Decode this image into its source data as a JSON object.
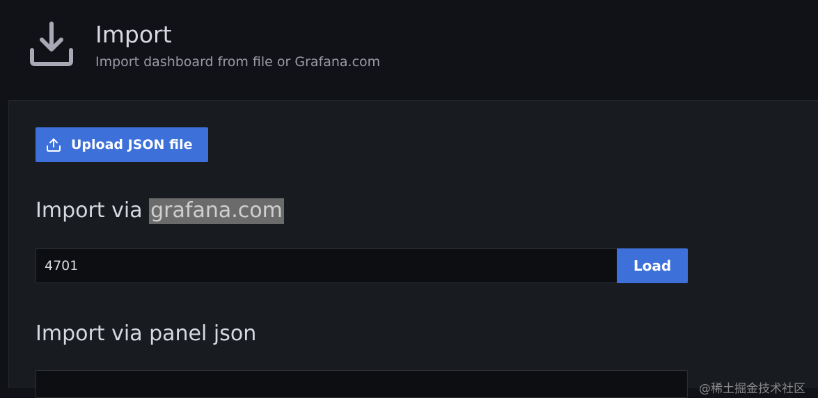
{
  "header": {
    "icon": "download-icon",
    "title": "Import",
    "subtitle": "Import dashboard from file or Grafana.com"
  },
  "upload": {
    "icon": "upload-icon",
    "label": "Upload JSON file"
  },
  "grafana_import": {
    "heading_prefix": "Import via ",
    "heading_highlight": "grafana.com",
    "input_value": "4701",
    "load_label": "Load"
  },
  "panel_json": {
    "heading": "Import via panel json"
  },
  "watermark": "@稀土掘金技术社区",
  "colors": {
    "primary": "#3d71d9",
    "background": "#111217",
    "panel": "#181b1f"
  }
}
